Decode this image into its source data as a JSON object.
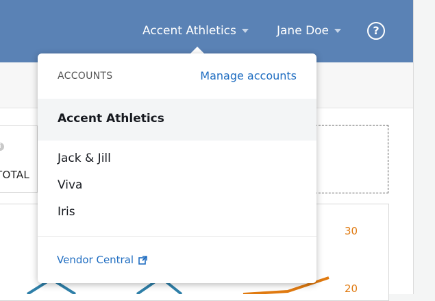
{
  "header": {
    "account_name": "Accent Athletics",
    "user_name": "Jane Doe",
    "help_glyph": "?"
  },
  "background": {
    "info_glyph": "i",
    "total_label": "TOTAL",
    "axis_labels": [
      "30",
      "20"
    ]
  },
  "dropdown": {
    "section_label": "ACCOUNTS",
    "manage_link": "Manage accounts",
    "selected_account": "Accent Athletics",
    "accounts": [
      "Jack & Jill",
      "Viva",
      "Iris"
    ],
    "vendor_link": "Vendor Central"
  },
  "colors": {
    "topbar": "#5a82b5",
    "link": "#1f6dc1",
    "axis_orange": "#e07a10",
    "line_blue": "#2e7fa8"
  },
  "icons": {
    "account_caret": "chevron-down-icon",
    "user_caret": "chevron-down-icon",
    "help": "question-circle-icon",
    "info": "info-icon",
    "external": "external-link-icon"
  }
}
